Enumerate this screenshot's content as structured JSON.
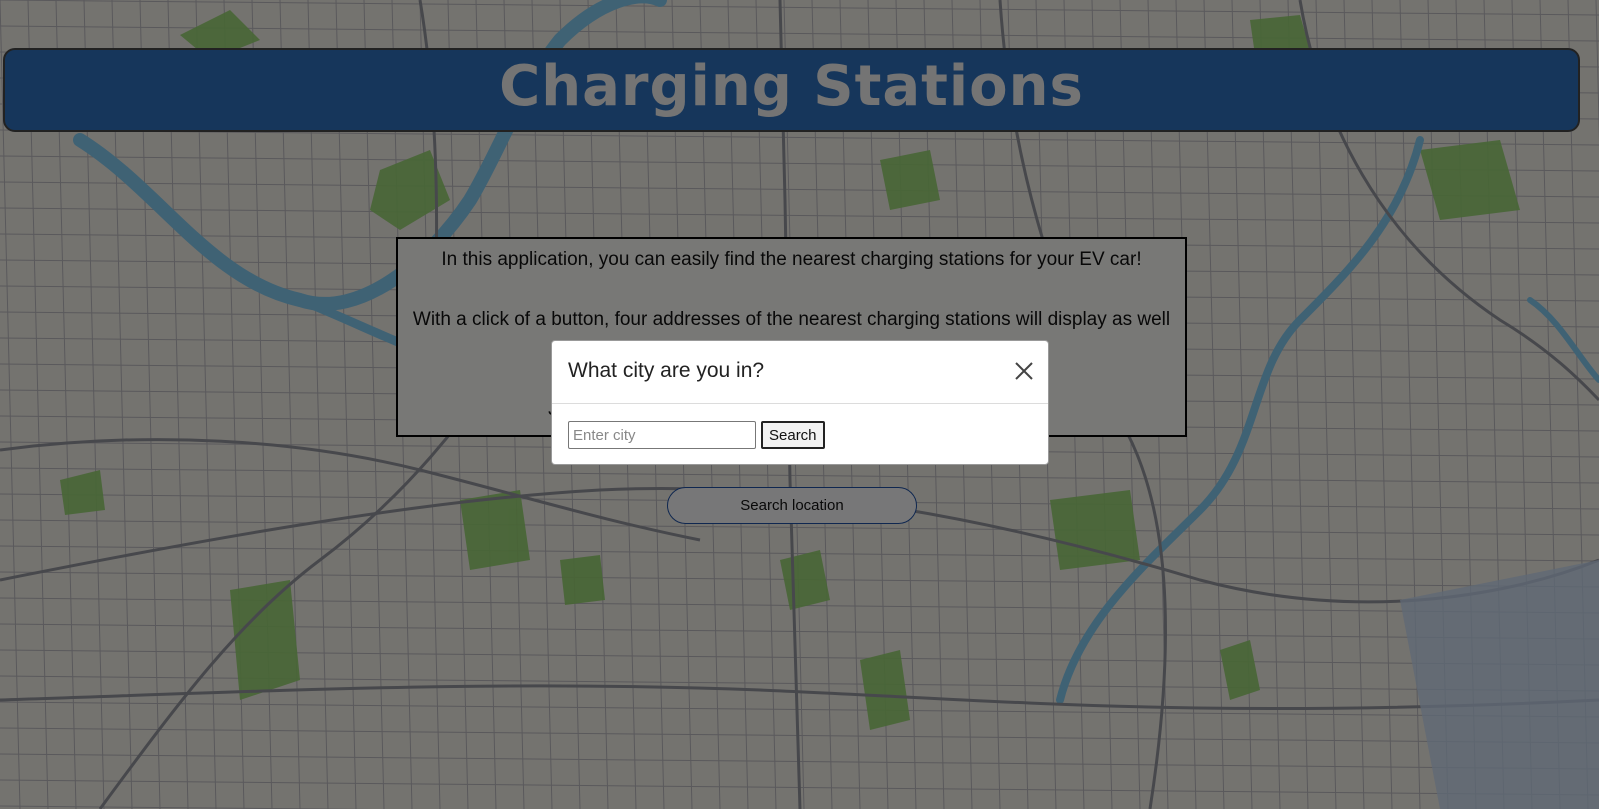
{
  "header": {
    "title": "Charging Stations"
  },
  "info": {
    "paragraph_1": "In this application, you can easily find the nearest charging stations for your EV car!",
    "paragraph_2": "With a click of a button, four addresses of the nearest charging stations will display as well as traffic reports, radio stations, and the weather!",
    "paragraph_3": "Just click Search location below and you are on your way!"
  },
  "search_location": {
    "label": "Search location"
  },
  "modal": {
    "title": "What city are you in?",
    "close_icon": "close-icon",
    "input_placeholder": "Enter city",
    "input_value": "",
    "search_label": "Search"
  },
  "colors": {
    "header_bg": "#2c6cb6",
    "header_text": "#e8e8e8",
    "button_border": "#1f4fa0",
    "overlay": "rgba(0,0,0,0.5)"
  },
  "background": {
    "type": "city-map",
    "water_color": "#7fc4e8",
    "park_color": "#8fcc6a",
    "street_color": "#9a9aa3",
    "land_color": "#e9e6df"
  }
}
